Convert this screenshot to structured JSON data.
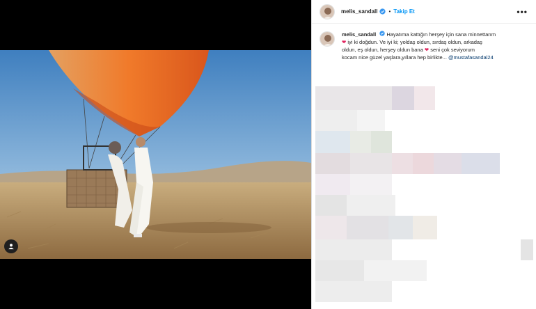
{
  "post": {
    "username": "melis_sandall",
    "follow_label": "Takip Et",
    "separator": "•",
    "more_label": "•••"
  },
  "caption": {
    "username": "melis_sandall",
    "line1": "Hayatıma kattığın herşey için sana minnettarım",
    "line2": "iyi ki doğdun. Ve iyi ki; yoldaş oldun, sırdaş oldun, arkadaş",
    "line3": "oldun, eş oldun, herşey oldun bana",
    "line4": "seni çok seviyorum",
    "line5": "kocam nice güzel yaşlara,yıllara hep birlikte...",
    "mention": "@mustafasandal24"
  },
  "icons": {
    "verified": "verified-badge-icon",
    "heart": "red-heart-icon",
    "tag": "user-tag-icon",
    "more": "more-options-icon"
  },
  "colors": {
    "follow": "#0095f6",
    "verified": "#3897f0",
    "heart": "#e0245e",
    "balloon_orange": "#f07a2a",
    "sky": "#5b95c7"
  }
}
